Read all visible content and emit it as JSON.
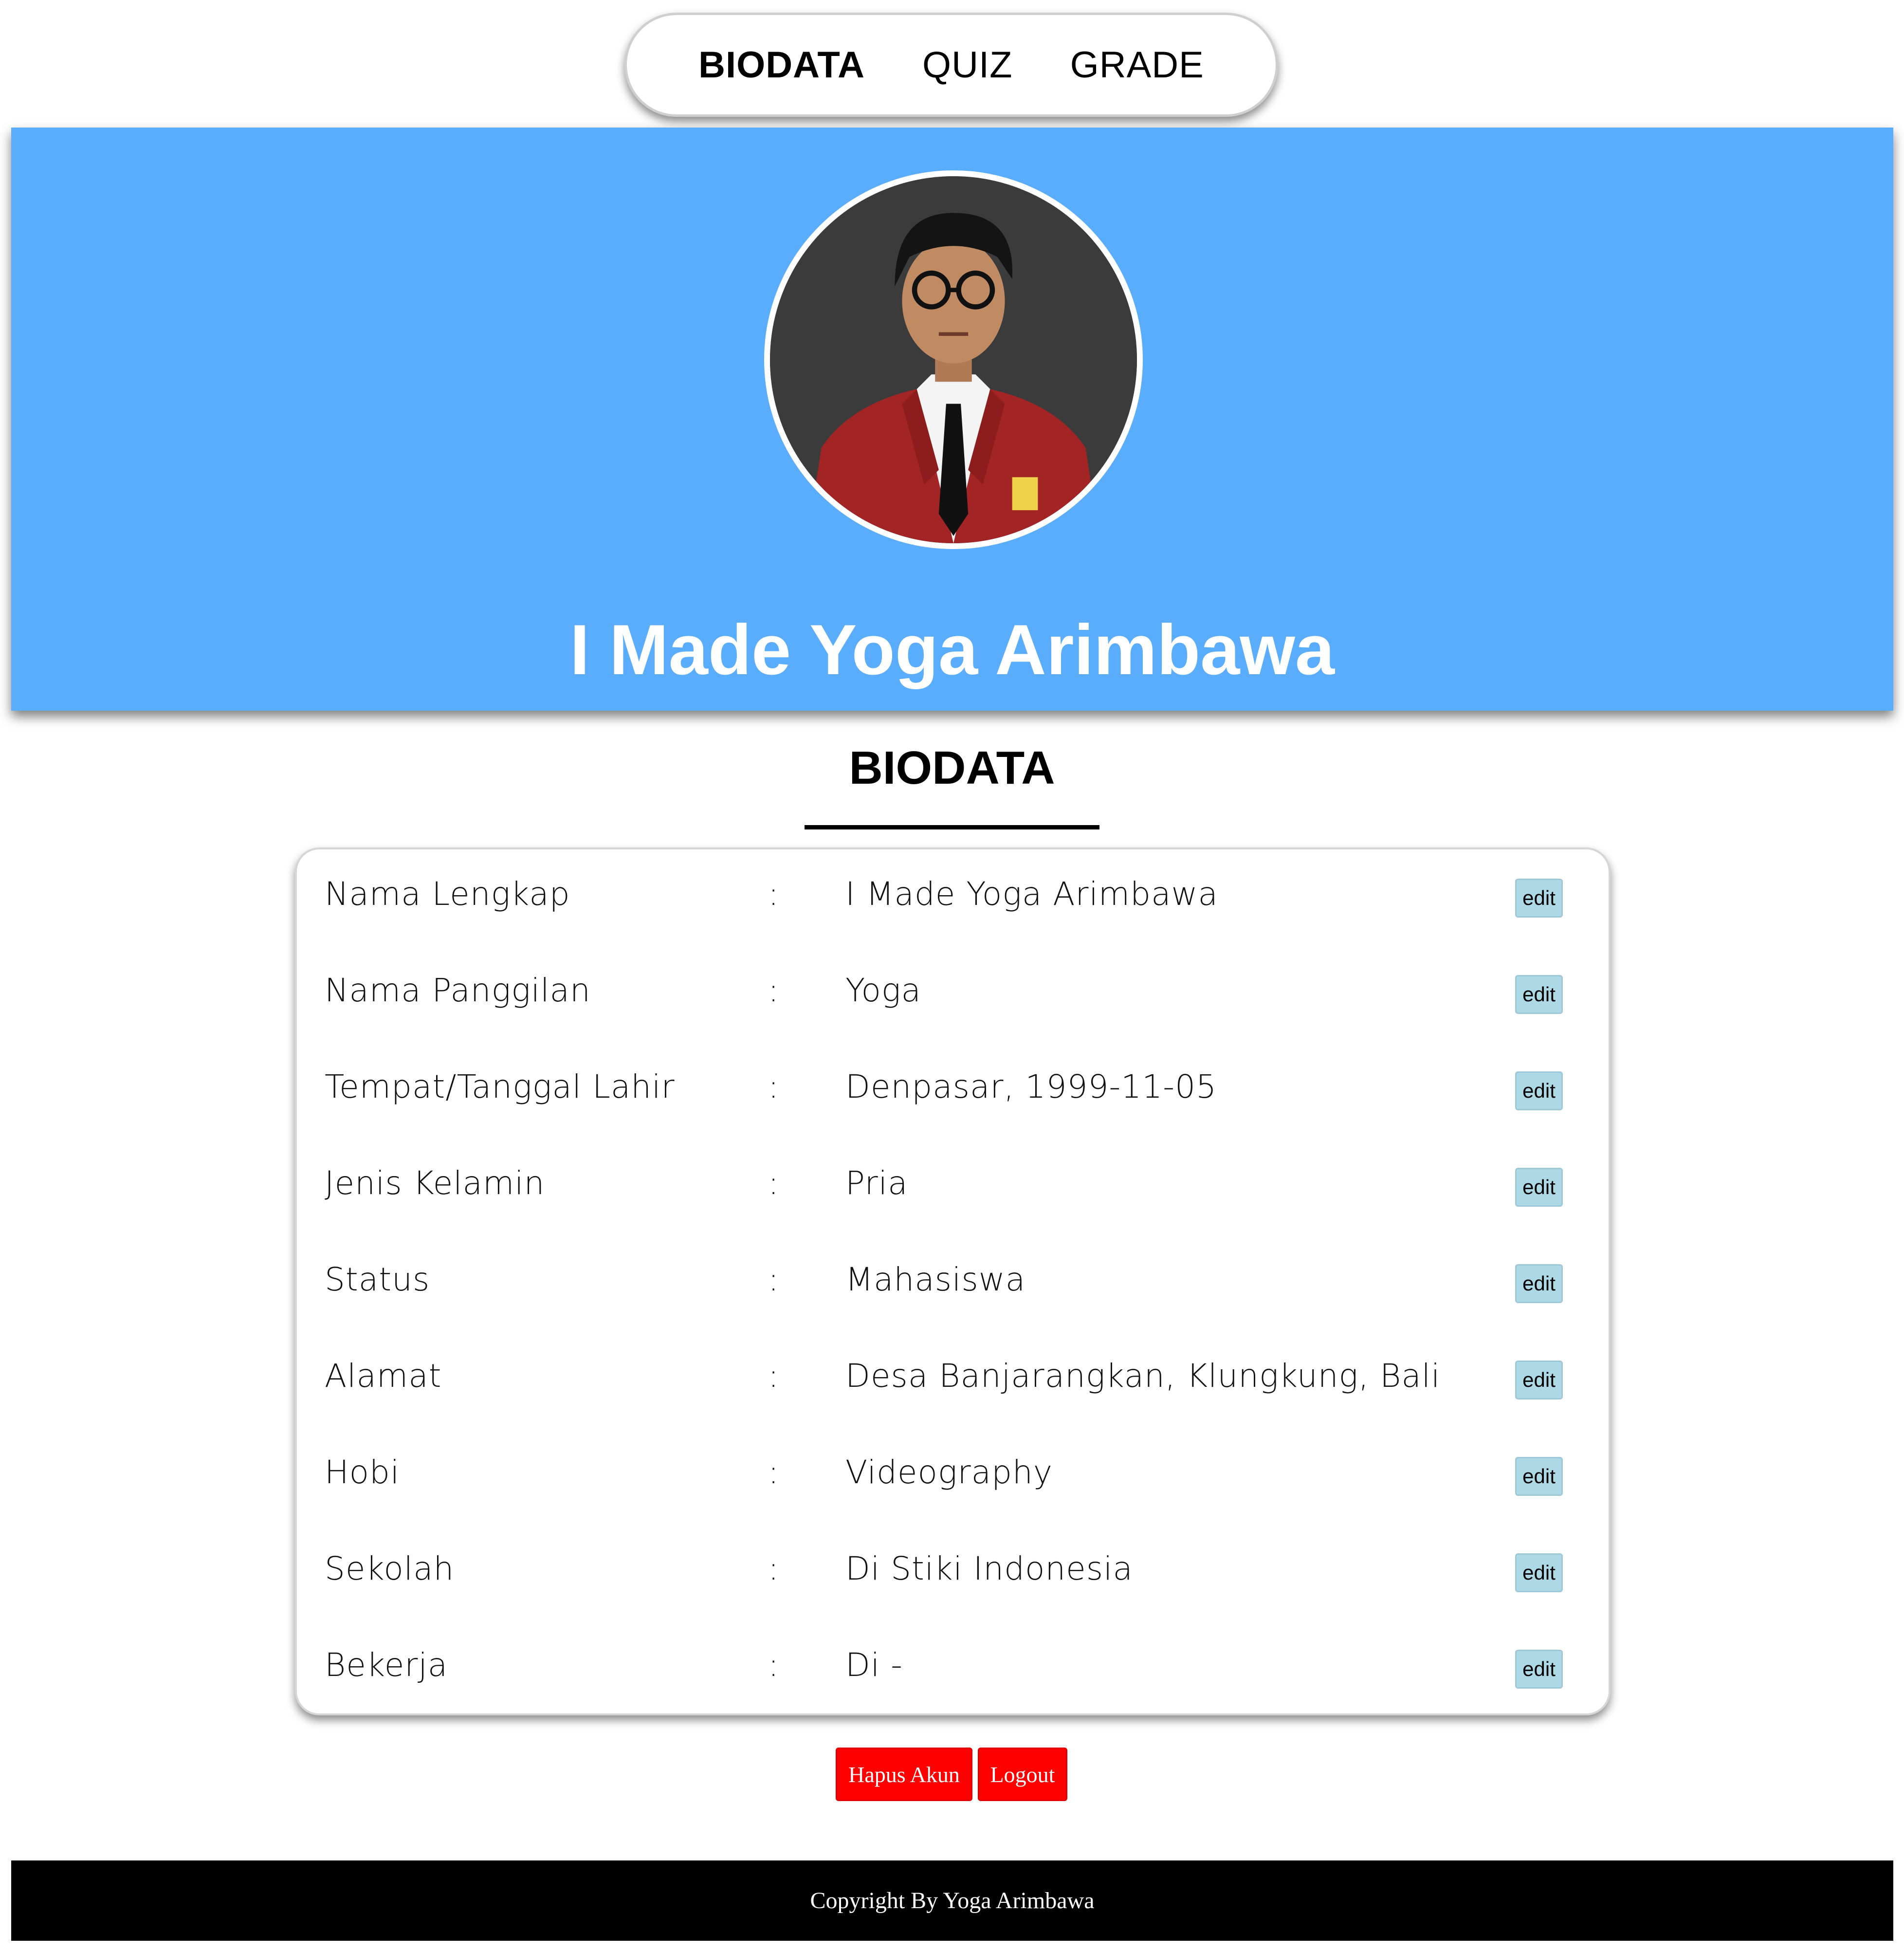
{
  "nav": {
    "items": [
      {
        "label": "BIODATA",
        "active": true
      },
      {
        "label": "QUIZ",
        "active": false
      },
      {
        "label": "GRADE",
        "active": false
      }
    ]
  },
  "hero": {
    "name": "I Made Yoga Arimbawa",
    "background_color": "#5aacfc"
  },
  "section": {
    "title": "BIODATA"
  },
  "biodata": {
    "separator": ":",
    "edit_label": "edit",
    "rows": [
      {
        "label": "Nama Lengkap",
        "value": "I Made Yoga Arimbawa"
      },
      {
        "label": "Nama Panggilan",
        "value": "Yoga"
      },
      {
        "label": "Tempat/Tanggal Lahir",
        "value": "Denpasar, 1999-11-05"
      },
      {
        "label": "Jenis Kelamin",
        "value": "Pria"
      },
      {
        "label": "Status",
        "value": "Mahasiswa"
      },
      {
        "label": "Alamat",
        "value": "Desa Banjarangkan, Klungkung, Bali"
      },
      {
        "label": "Hobi",
        "value": "Videography"
      },
      {
        "label": "Sekolah",
        "value": "Di Stiki Indonesia"
      },
      {
        "label": "Bekerja",
        "value": "Di -"
      }
    ]
  },
  "actions": {
    "delete_account": "Hapus Akun",
    "logout": "Logout",
    "button_color": "#ff0000"
  },
  "footer": {
    "text": "Copyright By Yoga Arimbawa"
  }
}
